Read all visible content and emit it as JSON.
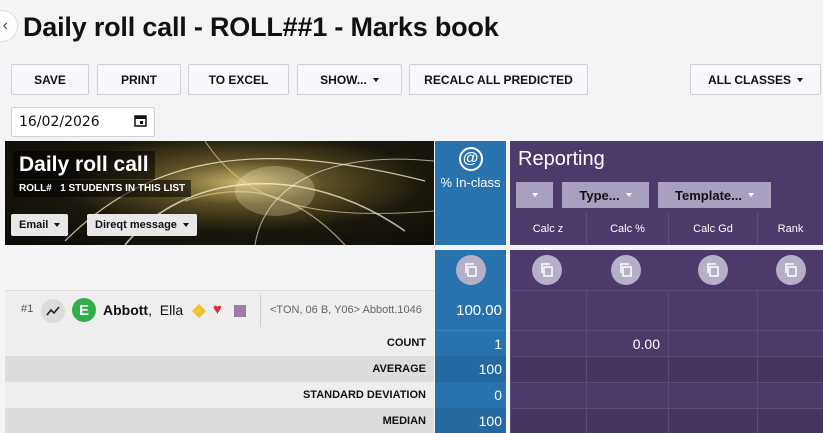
{
  "header": {
    "title": "Daily roll call - ROLL##1 - Marks book"
  },
  "toolbar": {
    "save": "SAVE",
    "print": "PRINT",
    "excel": "TO EXCEL",
    "show": "SHOW...",
    "recalc": "RECALC ALL PREDICTED",
    "classes": "ALL CLASSES"
  },
  "date": {
    "value": "16/02/2026"
  },
  "banner": {
    "title": "Daily roll call",
    "roll": "ROLL#",
    "students": "1 STUDENTS IN THIS LIST",
    "email": "Email",
    "message": "Direqt message"
  },
  "blue_column": {
    "icon": "@",
    "label": "% In-class"
  },
  "reporting": {
    "title": "Reporting",
    "type_btn": "Type...",
    "template_btn": "Template...",
    "columns": [
      "Calc z",
      "Calc %",
      "Calc Gd",
      "Rank"
    ]
  },
  "student": {
    "number": "#1",
    "initial": "E",
    "surname": "Abbott",
    "firstname": "Ella",
    "info": "<TON, 06 B, Y06> Abbott.1046",
    "in_class": "100.00"
  },
  "stats": [
    {
      "label": "COUNT",
      "in_class": "1",
      "calc_pct": "0.00"
    },
    {
      "label": "AVERAGE",
      "in_class": "100",
      "calc_pct": ""
    },
    {
      "label": "STANDARD DEVIATION",
      "in_class": "0",
      "calc_pct": ""
    },
    {
      "label": "MEDIAN",
      "in_class": "100",
      "calc_pct": ""
    }
  ],
  "colors": {
    "blue": "#2873ad",
    "purple": "#4c3a6a",
    "green": "#2fae4a"
  }
}
